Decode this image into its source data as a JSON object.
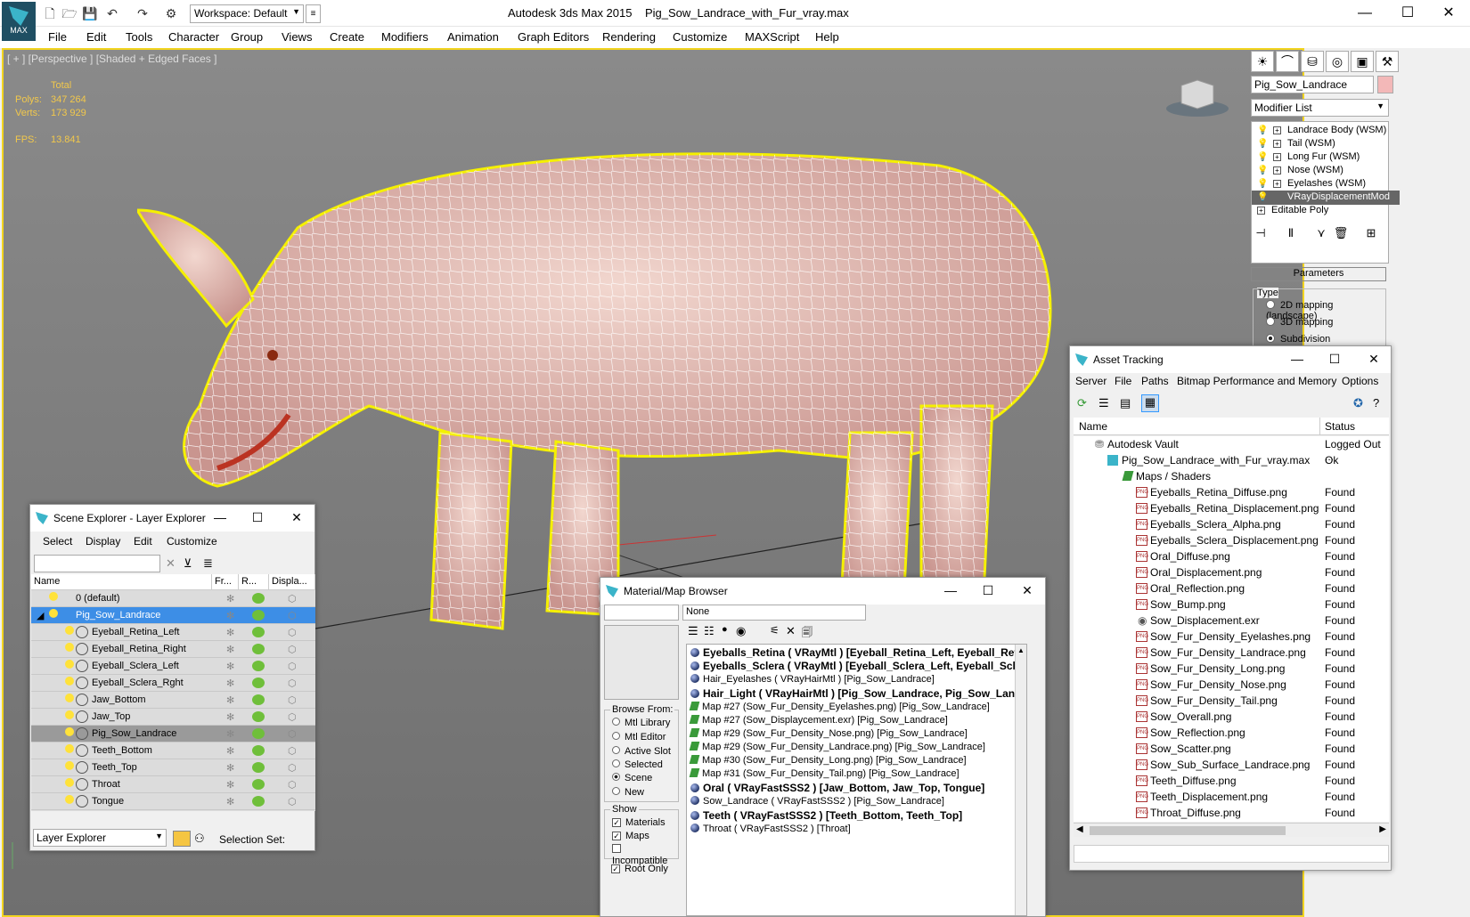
{
  "app": {
    "title": "Autodesk 3ds Max  2015",
    "file": "Pig_Sow_Landrace_with_Fur_vray.max",
    "logo": "MAX",
    "workspace": "Workspace: Default"
  },
  "menu": [
    "File",
    "Edit",
    "Tools",
    "Character",
    "Group",
    "Views",
    "Create",
    "Modifiers",
    "Animation",
    "Graph Editors",
    "Rendering",
    "Customize",
    "MAXScript",
    "Help"
  ],
  "viewport": {
    "label": "[ + ] [Perspective ] [Shaded + Edged Faces ]",
    "total_label": "Total",
    "polys_label": "Polys:",
    "polys": "347 264",
    "verts_label": "Verts:",
    "verts": "173 929",
    "fps_label": "FPS:",
    "fps": "13.841"
  },
  "command_panel": {
    "object_name": "Pig_Sow_Landrace",
    "modifier_list": "Modifier List",
    "stack": [
      "Landrace Body (WSM)",
      "Tail (WSM)",
      "Long Fur (WSM)",
      "Nose (WSM)",
      "Eyelashes (WSM)",
      "VRayDisplacementMod",
      "Editable Poly"
    ],
    "params": "Parameters",
    "type_label": "Type",
    "types": [
      "2D mapping (landscape)",
      "3D mapping",
      "Subdivision"
    ],
    "selected_type": 2
  },
  "scene_explorer": {
    "title": "Scene Explorer - Layer Explorer",
    "menu": [
      "Select",
      "Display",
      "Edit",
      "Customize"
    ],
    "columns": [
      "Name",
      "Fr...",
      "R...",
      "Displa..."
    ],
    "rows": [
      "0 (default)",
      "Pig_Sow_Landrace",
      "Eyeball_Retina_Left",
      "Eyeball_Retina_Right",
      "Eyeball_Sclera_Left",
      "Eyeball_Sclera_Rght",
      "Jaw_Bottom",
      "Jaw_Top",
      "Pig_Sow_Landrace",
      "Teeth_Bottom",
      "Teeth_Top",
      "Throat",
      "Tongue"
    ],
    "layer_explorer": "Layer Explorer",
    "selection_set": "Selection Set:"
  },
  "material_browser": {
    "title": "Material/Map Browser",
    "none": "None",
    "browse_from": "Browse From:",
    "browse": [
      "Mtl Library",
      "Mtl Editor",
      "Active Slot",
      "Selected",
      "Scene",
      "New"
    ],
    "show": "Show",
    "show_items": [
      "Materials",
      "Maps",
      "Incompatible"
    ],
    "root_only": "Root Only",
    "items": [
      "Eyeballs_Retina  ( VRayMtl )  [Eyeball_Retina_Left, Eyeball_Retina_",
      "Eyeballs_Sclera  ( VRayMtl )  [Eyeball_Sclera_Left, Eyeball_Sclera_",
      "Hair_Eyelashes  ( VRayHairMtl )  [Pig_Sow_Landrace]",
      "Hair_Light  ( VRayHairMtl )  [Pig_Sow_Landrace, Pig_Sow_Landrace",
      "Map #27 (Sow_Fur_Density_Eyelashes.png)  [Pig_Sow_Landrace]",
      "Map #27 (Sow_Displaycement.exr)  [Pig_Sow_Landrace]",
      "Map #29 (Sow_Fur_Density_Nose.png)  [Pig_Sow_Landrace]",
      "Map #29 (Sow_Fur_Density_Landrace.png)  [Pig_Sow_Landrace]",
      "Map #30 (Sow_Fur_Density_Long.png)  [Pig_Sow_Landrace]",
      "Map #31 (Sow_Fur_Density_Tail.png)  [Pig_Sow_Landrace]",
      "Oral  ( VRayFastSSS2 )  [Jaw_Bottom, Jaw_Top, Tongue]",
      "Sow_Landrace  ( VRayFastSSS2 )  [Pig_Sow_Landrace]",
      "Teeth  ( VRayFastSSS2 )  [Teeth_Bottom, Teeth_Top]",
      "Throat  ( VRayFastSSS2 )  [Throat]"
    ]
  },
  "asset_tracking": {
    "title": "Asset Tracking",
    "menu": [
      "Server",
      "File",
      "Paths",
      "Bitmap Performance and Memory",
      "Options"
    ],
    "col_name": "Name",
    "col_status": "Status",
    "vault": "Autodesk Vault",
    "vault_status": "Logged Out ...",
    "file": "Pig_Sow_Landrace_with_Fur_vray.max",
    "file_status": "Ok",
    "maps": "Maps / Shaders",
    "found": "Found",
    "assets": [
      "Eyeballs_Retina_Diffuse.png",
      "Eyeballs_Retina_Displacement.png",
      "Eyeballs_Sclera_Alpha.png",
      "Eyeballs_Sclera_Displacement.png",
      "Oral_Diffuse.png",
      "Oral_Displacement.png",
      "Oral_Reflection.png",
      "Sow_Bump.png",
      "Sow_Displacement.exr",
      "Sow_Fur_Density_Eyelashes.png",
      "Sow_Fur_Density_Landrace.png",
      "Sow_Fur_Density_Long.png",
      "Sow_Fur_Density_Nose.png",
      "Sow_Fur_Density_Tail.png",
      "Sow_Overall.png",
      "Sow_Reflection.png",
      "Sow_Scatter.png",
      "Sow_Sub_Surface_Landrace.png",
      "Teeth_Diffuse.png",
      "Teeth_Displacement.png",
      "Throat_Diffuse.png"
    ]
  }
}
